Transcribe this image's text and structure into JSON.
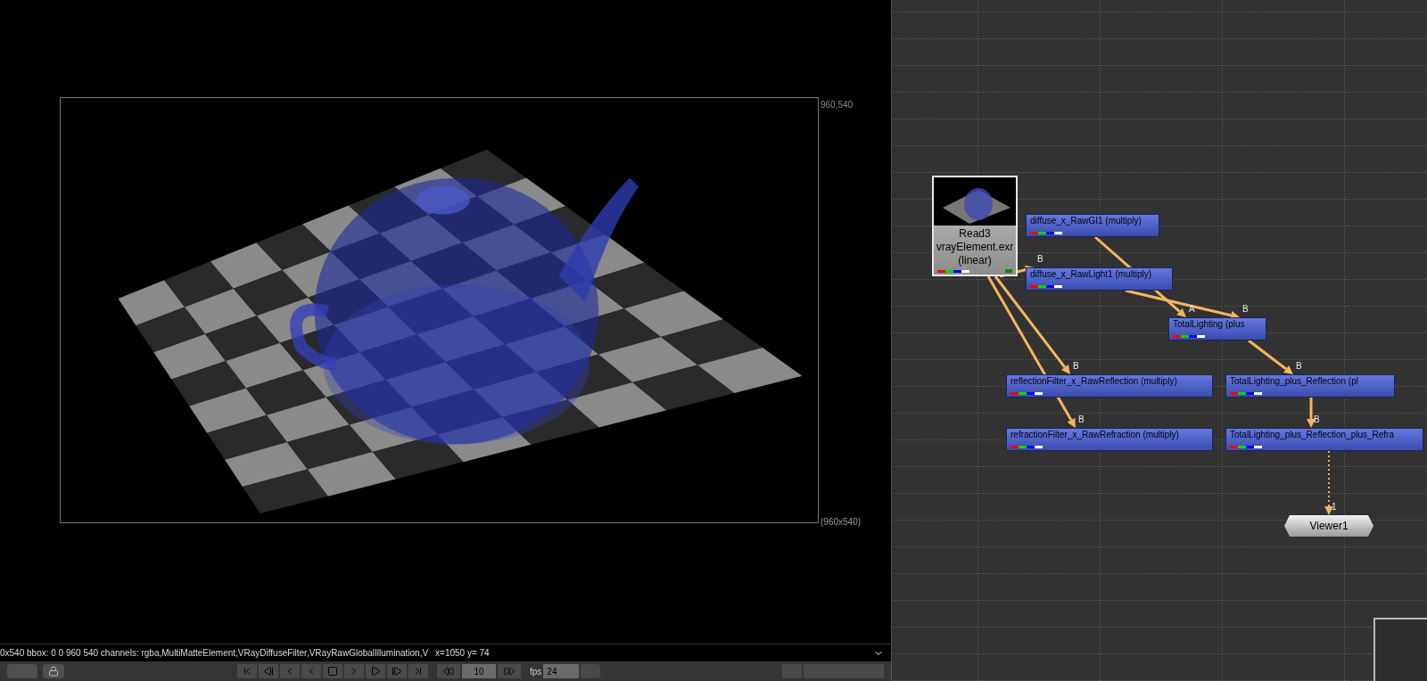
{
  "viewer": {
    "corner_label": "960,540",
    "format_label": "(960x540)",
    "info_text": "0x540 bbox: 0 0 960 540 channels: rgba,MultiMatteElement,VRayDiffuseFilter,VRayRawGlobalIllumination,V",
    "cursor_text": "x=1050 y=  74"
  },
  "playback": {
    "frame": "10",
    "fps_label": "fps",
    "fps": "24"
  },
  "node_graph": {
    "nodes": [
      {
        "kind": "read",
        "lines": [
          "Read3",
          "vrayElement.exr",
          "(linear)"
        ]
      },
      {
        "kind": "merge",
        "label": "diffuse_x_RawGI1 (multiply)"
      },
      {
        "kind": "merge",
        "label": "diffuse_x_RawLight1 (multiply)"
      },
      {
        "kind": "merge",
        "label": "TotalLighting (plus"
      },
      {
        "kind": "merge",
        "label": "reflectionFilter_x_RawReflection (multiply)"
      },
      {
        "kind": "merge",
        "label": "TotalLighting_plus_Reflection (pl"
      },
      {
        "kind": "merge",
        "label": "refractionFilter_x_RawRefraction (multiply)"
      },
      {
        "kind": "merge",
        "label": "TotalLighting_plus_Reflection_plus_Refra"
      },
      {
        "kind": "viewer",
        "label": "Viewer1"
      }
    ],
    "edges": [
      {
        "kind": "pipe",
        "input": "B"
      },
      {
        "kind": "pipe",
        "input": "B"
      },
      {
        "kind": "pipe",
        "input": "B"
      },
      {
        "kind": "pipe",
        "input": "A"
      },
      {
        "kind": "pipe",
        "input": "B"
      },
      {
        "kind": "pipe",
        "input": "B"
      },
      {
        "kind": "pipe",
        "input": "B"
      },
      {
        "kind": "link",
        "input": "1"
      }
    ]
  }
}
